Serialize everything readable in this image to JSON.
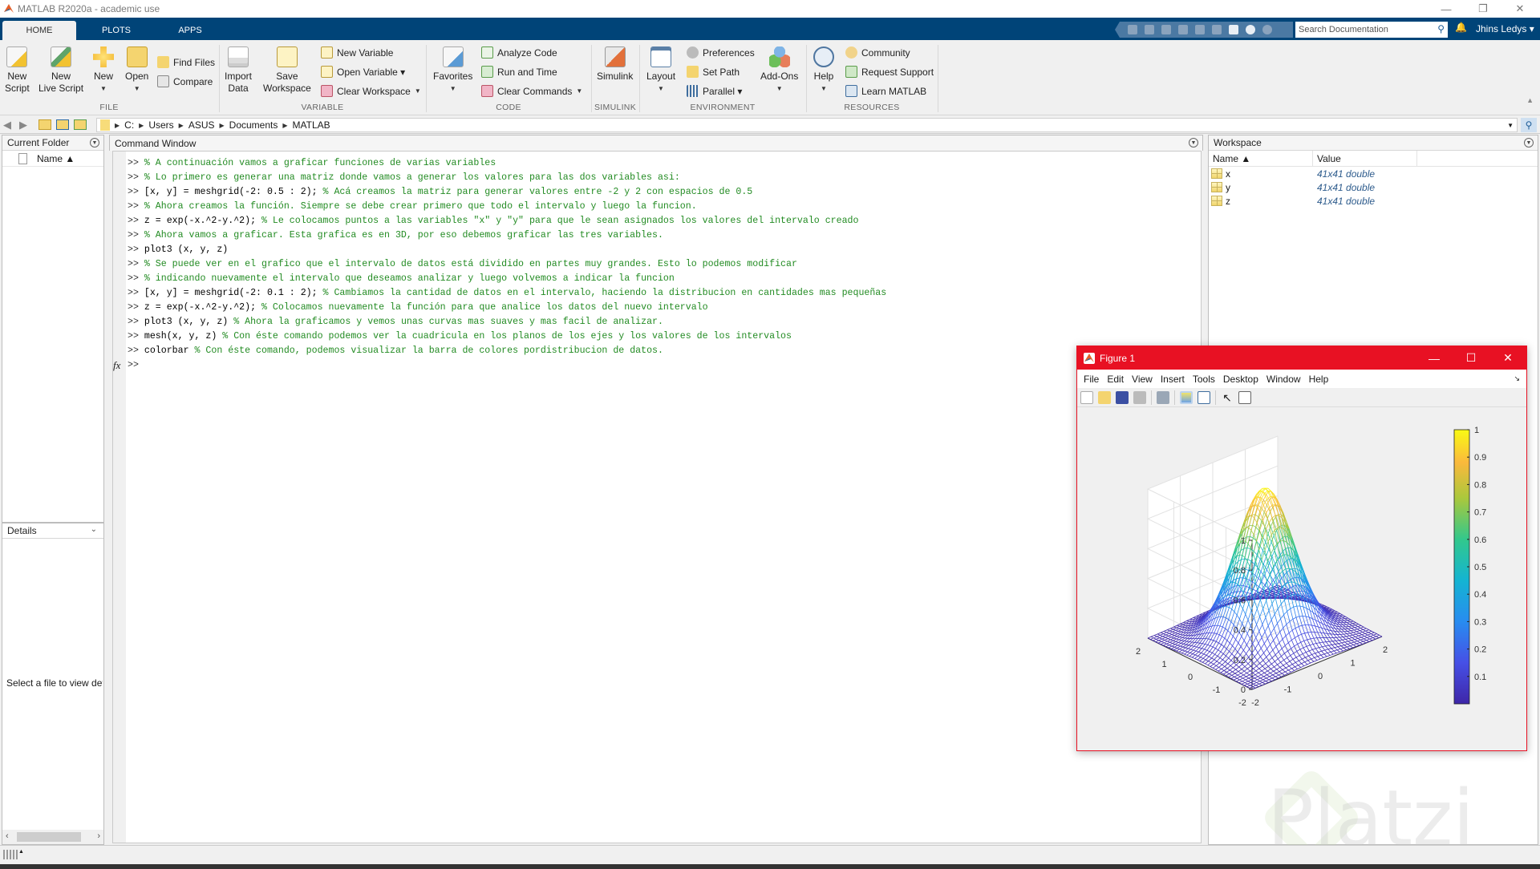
{
  "window": {
    "title": "MATLAB R2020a - academic use",
    "controls": {
      "minimize": "—",
      "restore": "❐",
      "close": "✕"
    }
  },
  "tabs": [
    {
      "label": "HOME",
      "active": true
    },
    {
      "label": "PLOTS",
      "active": false
    },
    {
      "label": "APPS",
      "active": false
    }
  ],
  "topbar": {
    "search_placeholder": "Search Documentation",
    "user": "Jhins Ledys ▾"
  },
  "ribbon": {
    "file": {
      "section": "FILE",
      "new_script": [
        "New",
        "Script"
      ],
      "new_live_script": [
        "New",
        "Live Script"
      ],
      "new": "New",
      "open": "Open",
      "find_files": "Find Files",
      "compare": "Compare"
    },
    "variable": {
      "section": "VARIABLE",
      "import_data": [
        "Import",
        "Data"
      ],
      "save_workspace": [
        "Save",
        "Workspace"
      ],
      "new_variable": "New Variable",
      "open_variable": "Open Variable ▾",
      "clear_workspace": "Clear Workspace"
    },
    "code": {
      "section": "CODE",
      "favorites": "Favorites",
      "analyze_code": "Analyze Code",
      "run_and_time": "Run and Time",
      "clear_commands": "Clear Commands"
    },
    "simulink": {
      "section": "SIMULINK",
      "simulink": "Simulink"
    },
    "environment": {
      "section": "ENVIRONMENT",
      "layout": "Layout",
      "preferences": "Preferences",
      "set_path": "Set Path",
      "parallel": "Parallel ▾",
      "add_ons": "Add-Ons"
    },
    "resources": {
      "section": "RESOURCES",
      "help": "Help",
      "community": "Community",
      "request_support": "Request Support",
      "learn_matlab": "Learn MATLAB"
    }
  },
  "address": {
    "path": [
      "C:",
      "Users",
      "ASUS",
      "Documents",
      "MATLAB"
    ]
  },
  "current_folder": {
    "title": "Current Folder",
    "col_name": "Name ▲",
    "details_title": "Details",
    "details_hint": "Select a file to view det"
  },
  "command_window": {
    "title": "Command Window",
    "lines": [
      {
        "code": "",
        "comment": "% A continuación vamos a graficar funciones de varias variables"
      },
      {
        "code": "",
        "comment": "% Lo primero es generar una matriz donde vamos a generar los valores para las dos variables asi:"
      },
      {
        "code": "[x, y] = meshgrid(-2: 0.5 : 2); ",
        "comment": "% Acá creamos la matriz para generar valores entre -2 y 2 con espacios de 0.5"
      },
      {
        "code": "",
        "comment": "% Ahora creamos la función. Siempre se debe crear primero que todo el intervalo y luego la funcion."
      },
      {
        "code": "z = exp(-x.^2-y.^2); ",
        "comment": "% Le colocamos puntos a las variables \"x\" y \"y\" para que le sean asignados los valores del intervalo creado"
      },
      {
        "code": "",
        "comment": "% Ahora vamos a graficar. Esta grafica es en 3D, por eso debemos graficar las tres variables."
      },
      {
        "code": "plot3 (x, y, z)",
        "comment": ""
      },
      {
        "code": "",
        "comment": "% Se puede ver en el grafico que el intervalo de datos está dividido en partes muy grandes. Esto lo podemos modificar"
      },
      {
        "code": "",
        "comment": "% indicando nuevamente el intervalo que deseamos analizar y luego volvemos a indicar la funcion"
      },
      {
        "code": "[x, y] = meshgrid(-2: 0.1 : 2); ",
        "comment": "% Cambiamos la cantidad de datos en el intervalo, haciendo la distribucion en cantidades mas pequeñas"
      },
      {
        "code": "z = exp(-x.^2-y.^2); ",
        "comment": "% Colocamos nuevamente la función para que analice los datos del nuevo intervalo"
      },
      {
        "code": "plot3 (x, y, z) ",
        "comment": "% Ahora la graficamos y vemos unas curvas mas suaves y mas facil de analizar."
      },
      {
        "code": "mesh(x, y, z) ",
        "comment": "% Con éste comando podemos ver la cuadricula en los planos de los ejes y los valores de los intervalos"
      },
      {
        "code": "colorbar ",
        "comment": "% Con éste comando, podemos visualizar la barra de colores pordistribucion de datos."
      }
    ],
    "prompt": ">>",
    "fx": "fx"
  },
  "workspace": {
    "title": "Workspace",
    "columns": [
      "Name ▲",
      "Value"
    ],
    "rows": [
      {
        "name": "x",
        "value": "41x41 double"
      },
      {
        "name": "y",
        "value": "41x41 double"
      },
      {
        "name": "z",
        "value": "41x41 double"
      }
    ]
  },
  "figure": {
    "title": "Figure 1",
    "menu": [
      "File",
      "Edit",
      "View",
      "Insert",
      "Tools",
      "Desktop",
      "Window",
      "Help"
    ]
  },
  "watermark": "Platzi",
  "chart_data": {
    "type": "mesh3d",
    "function": "z = exp(-x.^2 - y.^2)",
    "x": {
      "range": [
        -2,
        2
      ],
      "step": 0.1,
      "ticks": [
        "-2",
        "-1",
        "0",
        "1",
        "2"
      ]
    },
    "y": {
      "range": [
        -2,
        2
      ],
      "step": 0.1,
      "ticks": [
        "-2",
        "-1",
        "0",
        "1",
        "2"
      ]
    },
    "z": {
      "range": [
        0,
        1
      ],
      "ticks": [
        "0",
        "0.2",
        "0.4",
        "0.6",
        "0.8",
        "1"
      ]
    },
    "colormap": "parula",
    "colorbar": {
      "range": [
        0,
        1
      ],
      "ticks": [
        "0.1",
        "0.2",
        "0.3",
        "0.4",
        "0.5",
        "0.6",
        "0.7",
        "0.8",
        "0.9",
        "1"
      ],
      "placement": "right"
    },
    "grid": true,
    "title": "",
    "xlabel": "",
    "ylabel": "",
    "zlabel": ""
  }
}
